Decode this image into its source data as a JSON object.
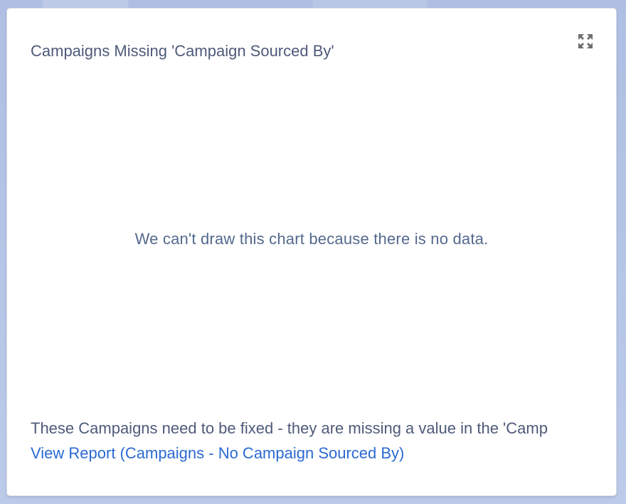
{
  "card": {
    "title": "Campaigns Missing 'Campaign Sourced By'",
    "expand_icon": "expand-arrows-icon",
    "empty_message": "We can't draw this chart because there is no data.",
    "footer_description": "These Campaigns need to be fixed - they are missing a value in the 'Camp",
    "report_link": "View Report (Campaigns - No Campaign Sourced By)"
  },
  "colors": {
    "background": "#b7c7e6",
    "title_text": "#4f5a7a",
    "link": "#2b6ad2",
    "icon": "#706e6b"
  }
}
